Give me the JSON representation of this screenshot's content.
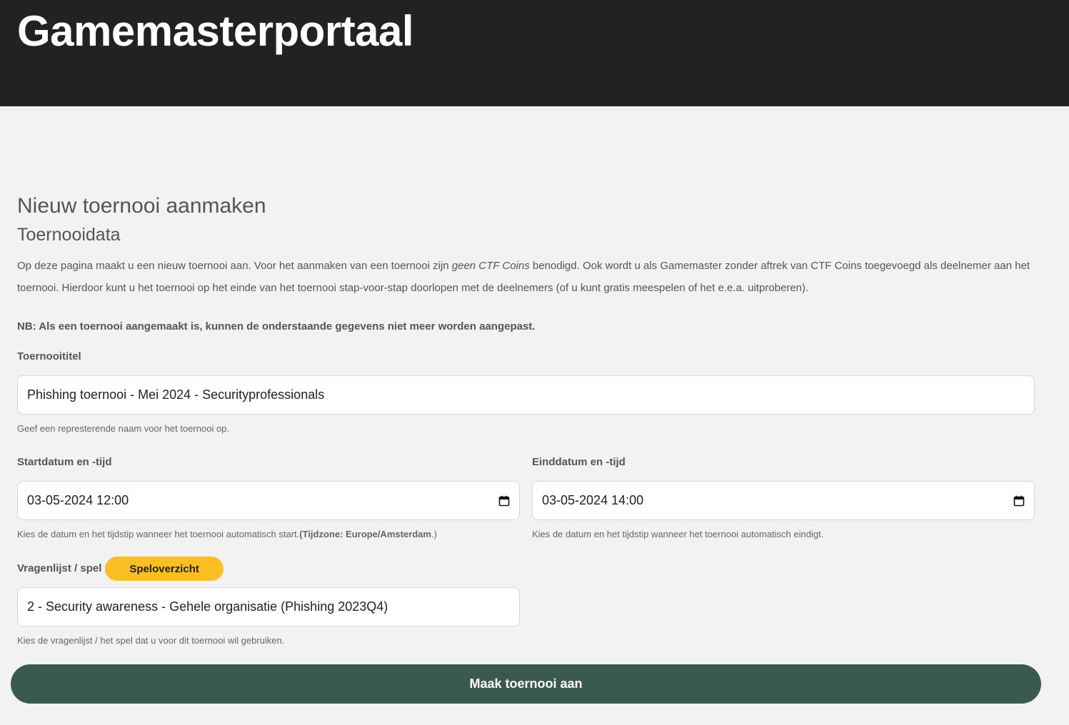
{
  "header": {
    "title": "Gamemasterportaal"
  },
  "page": {
    "title": "Nieuw toernooi aanmaken",
    "section_title": "Toernooidata",
    "intro_part1": "Op deze pagina maakt u een nieuw toernooi aan. Voor het aanmaken van een toernooi zijn ",
    "intro_emphasis": "geen CTF Coins",
    "intro_part2": " benodigd. Ook wordt u als Gamemaster zonder aftrek van CTF Coins toegevoegd als deelnemer aan het toernooi. Hierdoor kunt u het toernooi op het einde van het toernooi stap-voor-stap doorlopen met de deelnemers (of u kunt gratis meespelen of het e.e.a. uitproberen).",
    "note": "NB: Als een toernooi aangemaakt is, kunnen de onderstaande gegevens niet meer worden aangepast."
  },
  "form": {
    "title": {
      "label": "Toernooititel",
      "value": "Phishing toernooi - Mei 2024 - Securityprofessionals",
      "help": "Geef een represterende naam voor het toernooi op."
    },
    "start": {
      "label": "Startdatum en -tijd",
      "value": "03-05-2024 12:00",
      "help_text": "Kies de datum en het tijdstip wanneer het toernooi automatisch start.",
      "help_bold": "(Tijdzone: Europe/Amsterdam",
      "help_tail": ".)"
    },
    "end": {
      "label": "Einddatum en -tijd",
      "value": "03-05-2024 14:00",
      "help": "Kies de datum en het tijdstip wanneer het toernooi automatisch eindigt."
    },
    "game": {
      "label": "Vragenlijst / spel",
      "overview_button": "Speloverzicht",
      "value": "2 - Security awareness - Gehele organisatie (Phishing 2023Q4)",
      "help": "Kies de vragenlijst / het spel dat u voor dit toernooi wil gebruiken."
    },
    "submit_label": "Maak toernooi aan"
  },
  "icons": {
    "date_picker": "calendar-icon"
  }
}
